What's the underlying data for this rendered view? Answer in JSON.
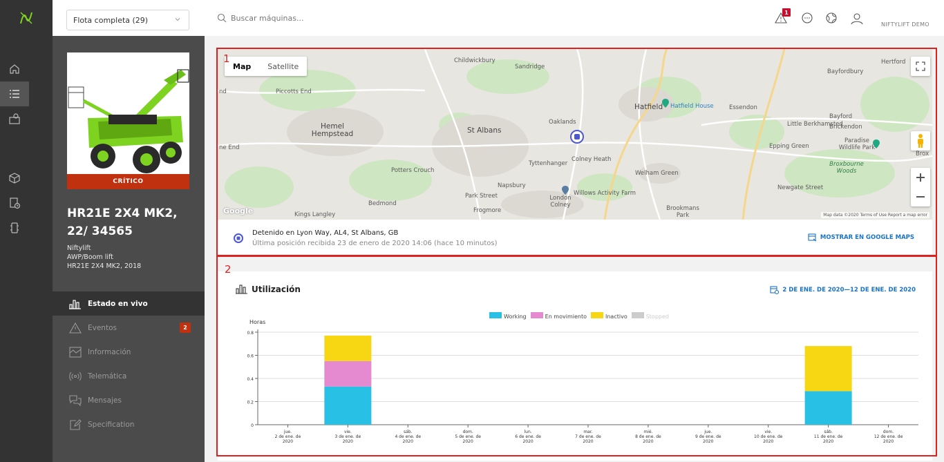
{
  "header": {
    "fleet_select": "Flota completa (29)",
    "search_placeholder": "Buscar máquinas...",
    "alert_count": "1",
    "user_name": "NIFTYLIFT DEMO"
  },
  "machine": {
    "status": "CRÍTICO",
    "title": "HR21E 2X4 MK2, 22/ 34565",
    "brand": "Niftylift",
    "category": "AWP/Boom lift",
    "model": "HR21E 2X4 MK2, 2018"
  },
  "nav": [
    {
      "label": "Estado en vivo",
      "icon": "chart-bars-icon",
      "active": true
    },
    {
      "label": "Eventos",
      "icon": "warning-icon",
      "badge": "2"
    },
    {
      "label": "Información",
      "icon": "info-doc-icon"
    },
    {
      "label": "Telemática",
      "icon": "signal-icon"
    },
    {
      "label": "Mensajes",
      "icon": "messages-icon"
    },
    {
      "label": "Specification",
      "icon": "edit-icon"
    }
  ],
  "map": {
    "type_map": "Map",
    "type_satellite": "Satellite",
    "labels": [
      "Childwickbury",
      "Sandridge",
      "Hertford",
      "Bayfordbury",
      "Piccotts End",
      "Hatfield",
      "Hatfield House",
      "Essendon",
      "Little Berkhamsted",
      "Bayford",
      "Brickendon",
      "Hemel Hempstead",
      "St Albans",
      "Oaklands",
      "Epping Green",
      "Paradise Wildlife Park",
      "Tyttenhanger",
      "Colney Heath",
      "Welham Green",
      "Potters Crouch",
      "Broxbourne Woods",
      "Napsbury",
      "Newgate Street",
      "Park Street",
      "London Colney",
      "Willows Activity Farm",
      "Bedmond",
      "Frogmore",
      "Kings Langley",
      "Brookmans Park",
      "nd",
      "ne End",
      "Brox"
    ],
    "attribution": "Map data ©2020   Terms of Use   Report a map error",
    "google": "Google",
    "location_main": "Detenido en Lyon Way, AL4, St Albans, GB",
    "location_sub": "Última posición recibida 23 de enero de 2020 14:06 (hace 10 minutos)",
    "gmaps_link": "MOSTRAR EN GOOGLE MAPS"
  },
  "utilization": {
    "title": "Utilización",
    "range": "2 DE ENE. DE 2020—12 DE ENE. DE 2020",
    "legend": [
      {
        "name": "Working",
        "color": "#29c0e6"
      },
      {
        "name": "En movimiento",
        "color": "#e58ad0"
      },
      {
        "name": "Inactivo",
        "color": "#f7d613"
      },
      {
        "name": "Stopped",
        "color": "#cccccc"
      }
    ]
  },
  "annotations": {
    "box1": "1",
    "box2": "2"
  },
  "chart_data": {
    "type": "bar",
    "stacked": true,
    "ylabel": "Horas",
    "ylim": [
      0,
      0.8
    ],
    "yticks": [
      "0.8",
      "0.6",
      "0.4",
      "0.2",
      "0"
    ],
    "categories": [
      [
        "jue.",
        "2 de ene. de",
        "2020"
      ],
      [
        "vie.",
        "3 de ene. de",
        "2020"
      ],
      [
        "sáb.",
        "4 de ene. de",
        "2020"
      ],
      [
        "dom.",
        "5 de ene. de",
        "2020"
      ],
      [
        "lun.",
        "6 de ene. de",
        "2020"
      ],
      [
        "mar.",
        "7 de ene. de",
        "2020"
      ],
      [
        "mié.",
        "8 de ene. de",
        "2020"
      ],
      [
        "jue.",
        "9 de ene. de",
        "2020"
      ],
      [
        "vie.",
        "10 de ene. de",
        "2020"
      ],
      [
        "sáb.",
        "11 de ene. de",
        "2020"
      ],
      [
        "dom.",
        "12 de ene. de",
        "2020"
      ]
    ],
    "series": [
      {
        "name": "Working",
        "color": "#29c0e6",
        "values": [
          0,
          0.33,
          0,
          0,
          0,
          0,
          0,
          0,
          0,
          0.29,
          0,
          0
        ]
      },
      {
        "name": "En movimiento",
        "color": "#e58ad0",
        "values": [
          0,
          0.22,
          0,
          0,
          0,
          0,
          0,
          0,
          0,
          0,
          0,
          0
        ]
      },
      {
        "name": "Inactivo",
        "color": "#f7d613",
        "values": [
          0,
          0.22,
          0,
          0,
          0,
          0,
          0,
          0,
          0,
          0.39,
          0,
          0
        ]
      },
      {
        "name": "Stopped",
        "color": "#cccccc",
        "values": [
          0,
          0,
          0,
          0,
          0,
          0,
          0,
          0,
          0,
          0,
          0,
          0
        ]
      }
    ],
    "legend_position": "top-center"
  }
}
